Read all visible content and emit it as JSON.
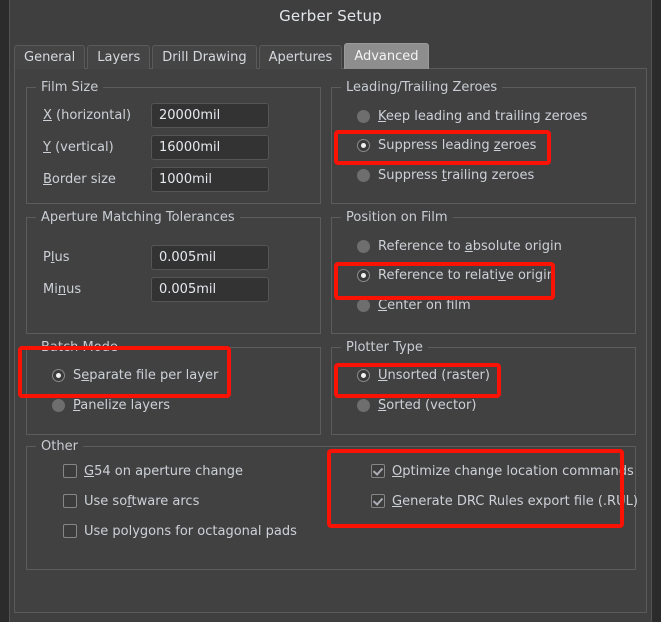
{
  "window": {
    "title": "Gerber Setup"
  },
  "tabs": [
    {
      "label": "General",
      "active": false
    },
    {
      "label": "Layers",
      "active": false
    },
    {
      "label": "Drill Drawing",
      "active": false
    },
    {
      "label": "Apertures",
      "active": false
    },
    {
      "label": "Advanced",
      "active": true
    }
  ],
  "film_size": {
    "title": "Film Size",
    "fields": [
      {
        "label_pre": "",
        "label_acc": "X",
        "label_post": " (horizontal)",
        "value": "20000mil"
      },
      {
        "label_pre": "",
        "label_acc": "Y",
        "label_post": " (vertical)",
        "value": "16000mil"
      },
      {
        "label_pre": "",
        "label_acc": "B",
        "label_post": "order size",
        "value": "1000mil"
      }
    ]
  },
  "aperture_tolerances": {
    "title": "Aperture Matching Tolerances",
    "fields": [
      {
        "label_pre": "P",
        "label_acc": "l",
        "label_post": "us",
        "value": "0.005mil"
      },
      {
        "label_pre": "Mi",
        "label_acc": "n",
        "label_post": "us",
        "value": "0.005mil"
      }
    ]
  },
  "batch_mode": {
    "title": "Batch Mode",
    "options": [
      {
        "pre": "S",
        "acc": "e",
        "post": "parate file per layer",
        "selected": true,
        "highlighted": true
      },
      {
        "pre": "",
        "acc": "P",
        "post": "anelize layers",
        "selected": false,
        "highlighted": false
      }
    ]
  },
  "other": {
    "title": "Other",
    "left_checks": [
      {
        "pre": "",
        "acc": "G",
        "post": "54 on aperture change",
        "checked": false
      },
      {
        "pre": "Use so",
        "acc": "f",
        "post": "tware arcs",
        "checked": false
      },
      {
        "pre": "Use polygons for octagonal pads",
        "acc": "",
        "post": "",
        "checked": false
      }
    ],
    "right_checks": [
      {
        "pre": "",
        "acc": "O",
        "post": "ptimize change location commands",
        "checked": true
      },
      {
        "pre": "",
        "acc": "G",
        "post": "enerate DRC Rules export file (.RUL)",
        "checked": true
      }
    ]
  },
  "zeroes": {
    "title": "Leading/Trailing Zeroes",
    "options": [
      {
        "pre": "",
        "acc": "K",
        "post": "eep leading and trailing zeroes",
        "selected": false,
        "highlighted": false
      },
      {
        "pre": "Suppress leading ",
        "acc": "z",
        "post": "eroes",
        "selected": true,
        "highlighted": true
      },
      {
        "pre": "Suppress ",
        "acc": "t",
        "post": "railing zeroes",
        "selected": false,
        "highlighted": false
      }
    ]
  },
  "position_on_film": {
    "title": "Position on Film",
    "options": [
      {
        "pre": "Reference to ",
        "acc": "a",
        "post": "bsolute origin",
        "selected": false,
        "highlighted": false
      },
      {
        "pre": "Reference to relati",
        "acc": "v",
        "post": "e origin",
        "selected": true,
        "highlighted": true
      },
      {
        "pre": "",
        "acc": "C",
        "post": "enter on film",
        "selected": false,
        "highlighted": false
      }
    ]
  },
  "plotter_type": {
    "title": "Plotter Type",
    "options": [
      {
        "pre": "",
        "acc": "U",
        "post": "nsorted (raster)",
        "selected": true,
        "highlighted": true
      },
      {
        "pre": "",
        "acc": "S",
        "post": "orted (vector)",
        "selected": false,
        "highlighted": false
      }
    ]
  },
  "annotation_color": "#fa1304"
}
